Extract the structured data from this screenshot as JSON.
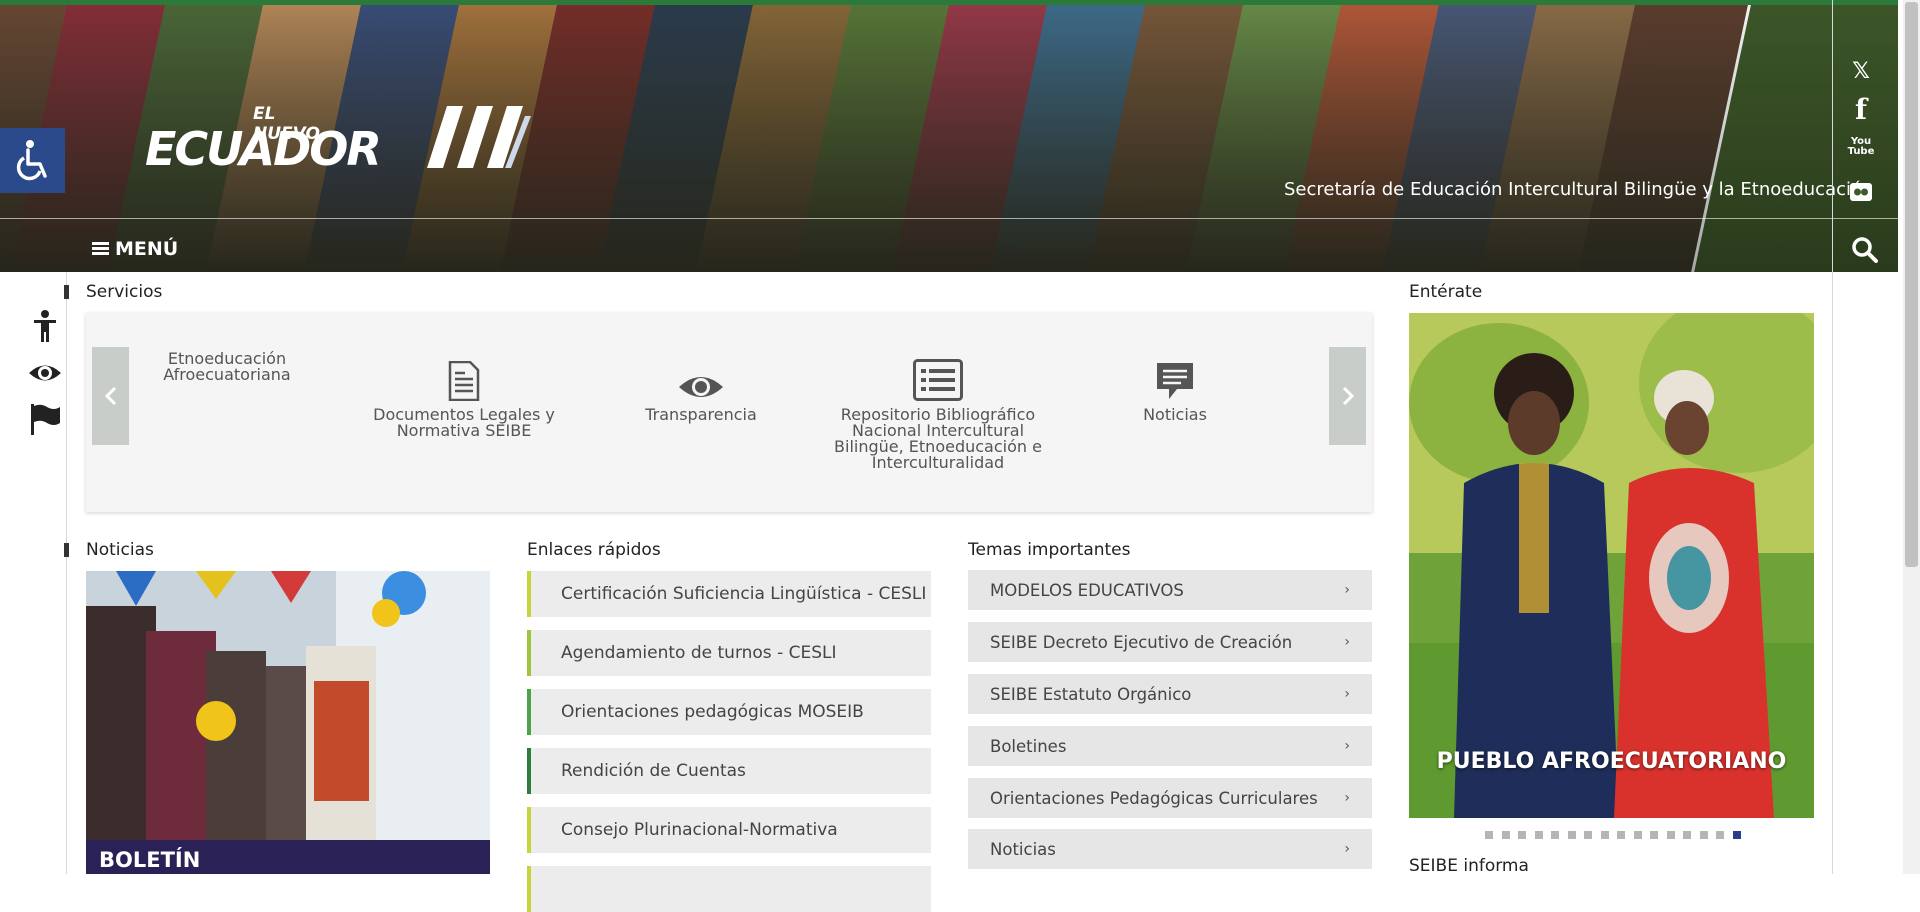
{
  "header": {
    "logo": {
      "small_text": "EL NUEVO",
      "main_text": "ECUADOR"
    },
    "tagline": "Secretaría de Educación Intercultural Bilingüe y la Etnoeducación",
    "menu_label": "MENÚ",
    "social": [
      {
        "name": "x-icon",
        "glyph": "𝕏"
      },
      {
        "name": "facebook-icon",
        "glyph": "f"
      },
      {
        "name": "youtube-icon",
        "glyph": "You Tube"
      },
      {
        "name": "flickr-icon",
        "glyph": "●●"
      }
    ],
    "colors": {
      "top_bar": "#2b7a3a",
      "accessibility_button": "#2b4a8b"
    }
  },
  "left_tools": [
    {
      "name": "accessibility-person-icon"
    },
    {
      "name": "eye-icon"
    },
    {
      "name": "flag-icon"
    }
  ],
  "services": {
    "title": "Servicios",
    "items": [
      {
        "label": "Etnoeducación Afroecuatoriana",
        "icon": "none"
      },
      {
        "label": "Documentos Legales y Normativa SEIBE",
        "icon": "document-icon"
      },
      {
        "label": "Transparencia",
        "icon": "eye-icon"
      },
      {
        "label": "Repositorio Bibliográfico Nacional Intercultural Bilingüe, Etnoeducación e Interculturalidad",
        "icon": "list-icon"
      },
      {
        "label": "Noticias",
        "icon": "chat-icon"
      }
    ]
  },
  "news": {
    "title": "Noticias",
    "banner_label": "BOLETÍN"
  },
  "quick_links": {
    "title": "Enlaces rápidos",
    "items": [
      "Certificación Suficiencia Lingüística - CESLI",
      "Agendamiento de turnos - CESLI",
      "Orientaciones pedagógicas MOSEIB",
      "Rendición de Cuentas",
      "Consejo Plurinacional-Normativa"
    ],
    "accent_colors": [
      "#c7d33b",
      "#9fc43d",
      "#4ea24a",
      "#2e7d3a",
      "#c7d33b"
    ]
  },
  "topics": {
    "title": "Temas importantes",
    "items": [
      "MODELOS EDUCATIVOS",
      "SEIBE Decreto Ejecutivo de Creación",
      "SEIBE Estatuto Orgánico",
      "Boletines",
      "Orientaciones Pedagógicas Curriculares",
      "Noticias"
    ]
  },
  "enterate": {
    "title": "Entérate",
    "caption": "PUEBLO AFROECUATORIANO",
    "dots_total": 16,
    "active_dot": 16
  },
  "seibe_informa": {
    "title": "SEIBE informa"
  }
}
